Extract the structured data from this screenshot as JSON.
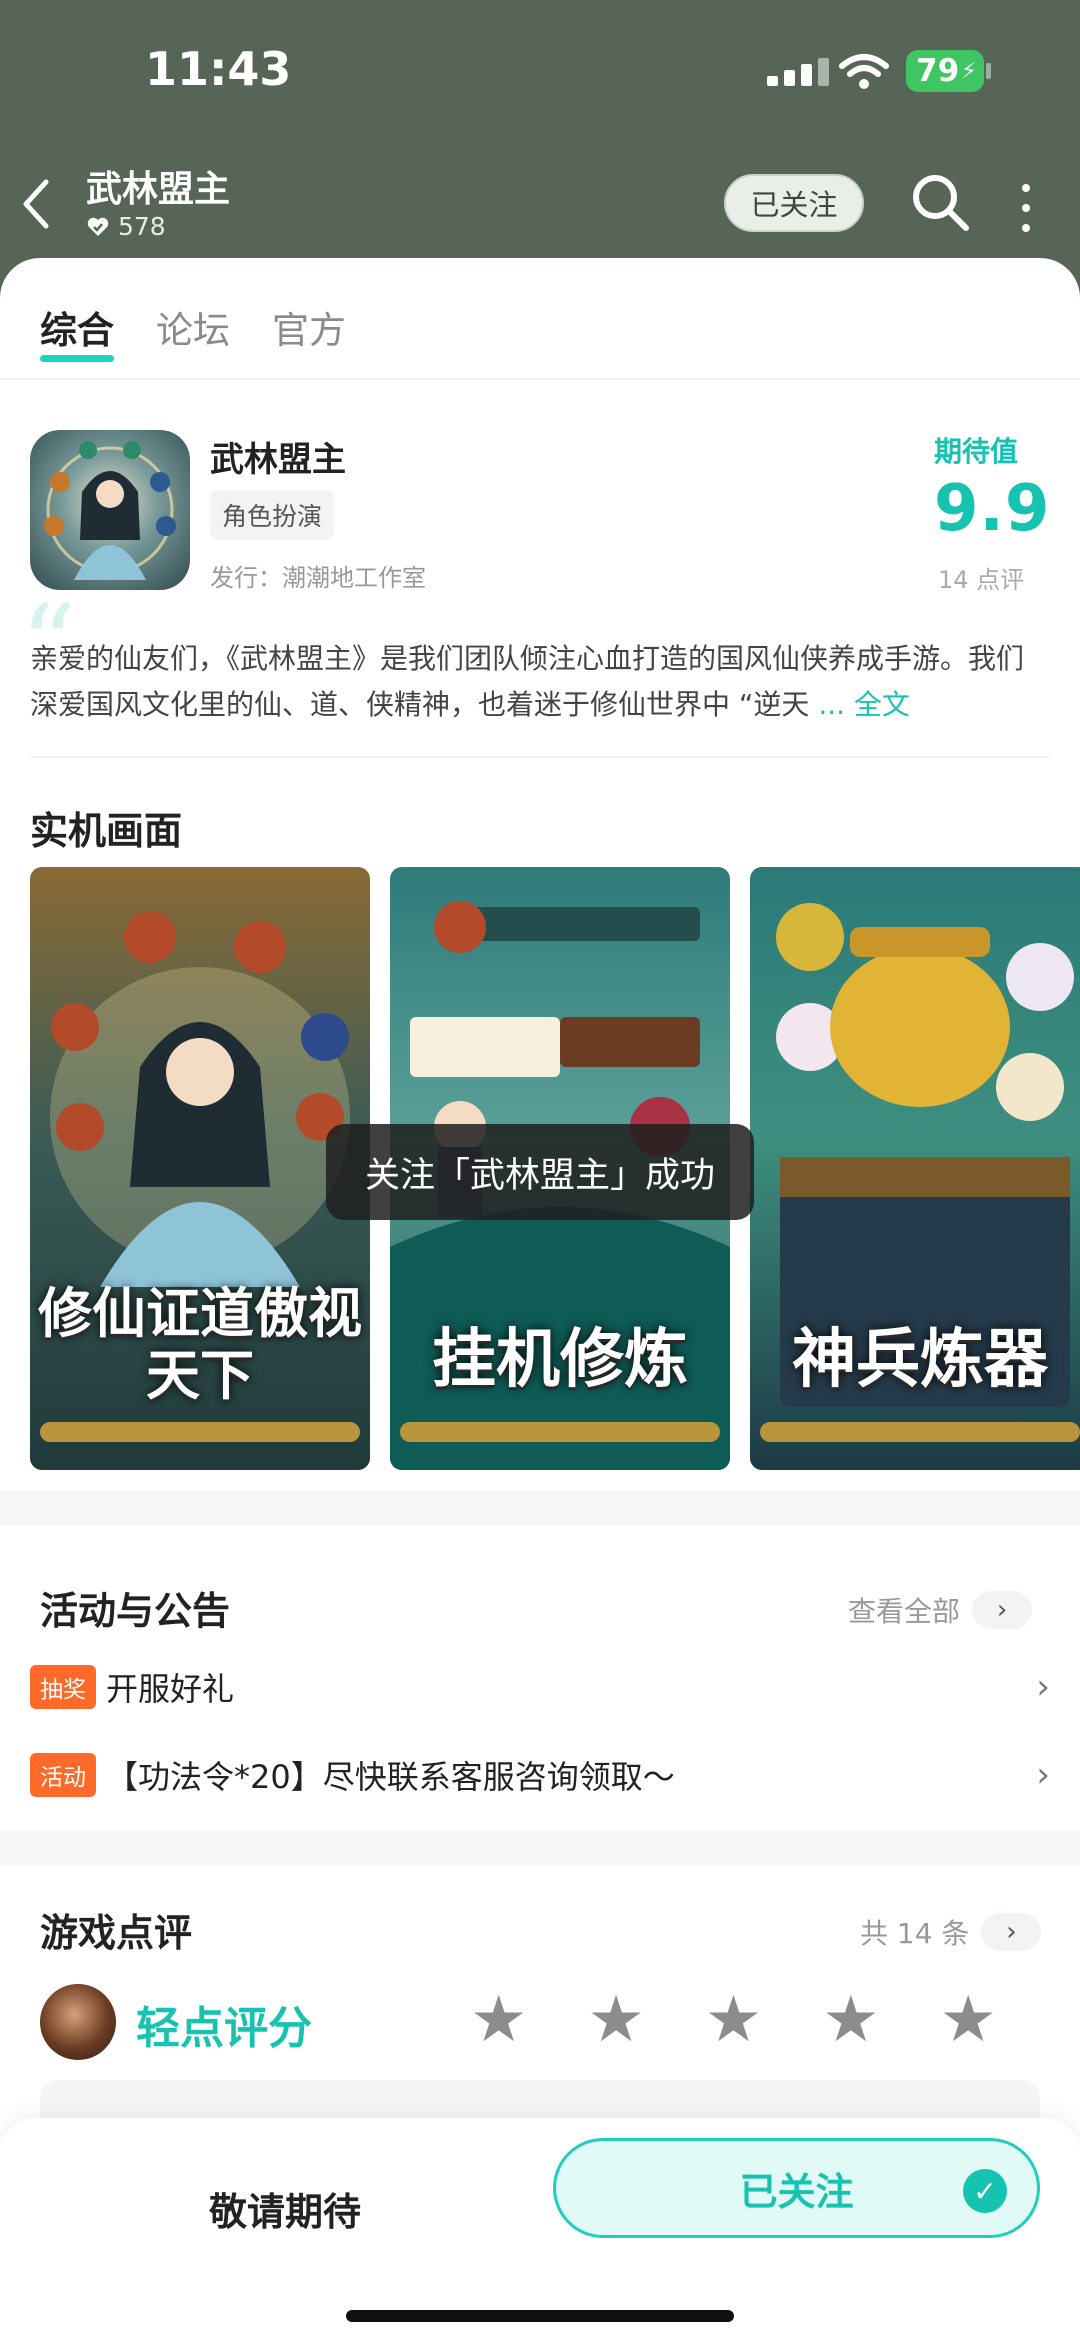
{
  "status_bar": {
    "time": "11:43",
    "battery": "79"
  },
  "header": {
    "title": "武林盟主",
    "follower_count": "578",
    "follow_state": "已关注"
  },
  "tabs": [
    {
      "label": "综合",
      "active": true
    },
    {
      "label": "论坛",
      "active": false
    },
    {
      "label": "官方",
      "active": false
    }
  ],
  "game": {
    "name": "武林盟主",
    "genre": "角色扮演",
    "publisher": "发行：潮潮地工作室",
    "expectation_label": "期待值",
    "expectation_value": "9.9",
    "rating_count": "14 点评",
    "description": "亲爱的仙友们，《武林盟主》是我们团队倾注心血打造的国风仙侠养成手游。我们深爱国风文化里的仙、道、侠精神，也着迷于修仙世界中 “逆天",
    "read_more": "... 全文"
  },
  "screenshots": {
    "title": "实机画面",
    "items": [
      {
        "caption": "修仙证道傲视天下"
      },
      {
        "caption": "挂机修炼"
      },
      {
        "caption": "神兵炼器"
      }
    ]
  },
  "toast": "关注「武林盟主」成功",
  "news": {
    "title": "活动与公告",
    "see_all": "查看全部",
    "items": [
      {
        "tag": "抽奖",
        "text": "开服好礼"
      },
      {
        "tag": "活动",
        "text": "【功法令*20】尽快联系客服咨询领取～"
      }
    ]
  },
  "reviews": {
    "title": "游戏点评",
    "count": "共 14 条",
    "tap_to_rate": "轻点评分"
  },
  "bottom": {
    "await_label": "敬请期待",
    "followed_label": "已关注"
  },
  "colors": {
    "accent": "#16c3b0",
    "header_bg": "#566556",
    "tag": "#ff6a2a"
  }
}
